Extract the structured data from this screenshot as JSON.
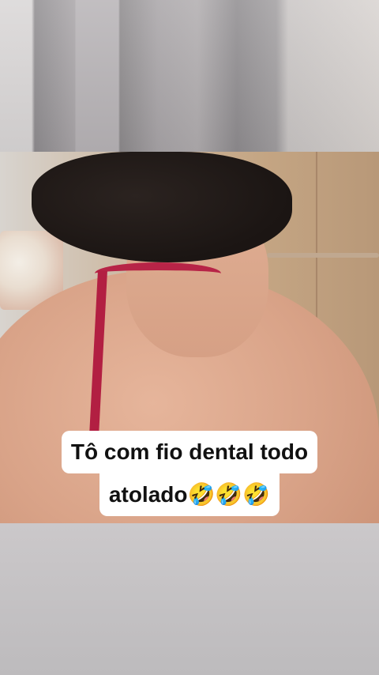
{
  "caption": {
    "line1": "Tô com fio dental todo",
    "line2": "atolado🤣🤣🤣"
  },
  "colors": {
    "caption_bg": "#ffffff",
    "caption_text": "#111111",
    "strap": "#b72447",
    "hair": "#1b1513"
  }
}
